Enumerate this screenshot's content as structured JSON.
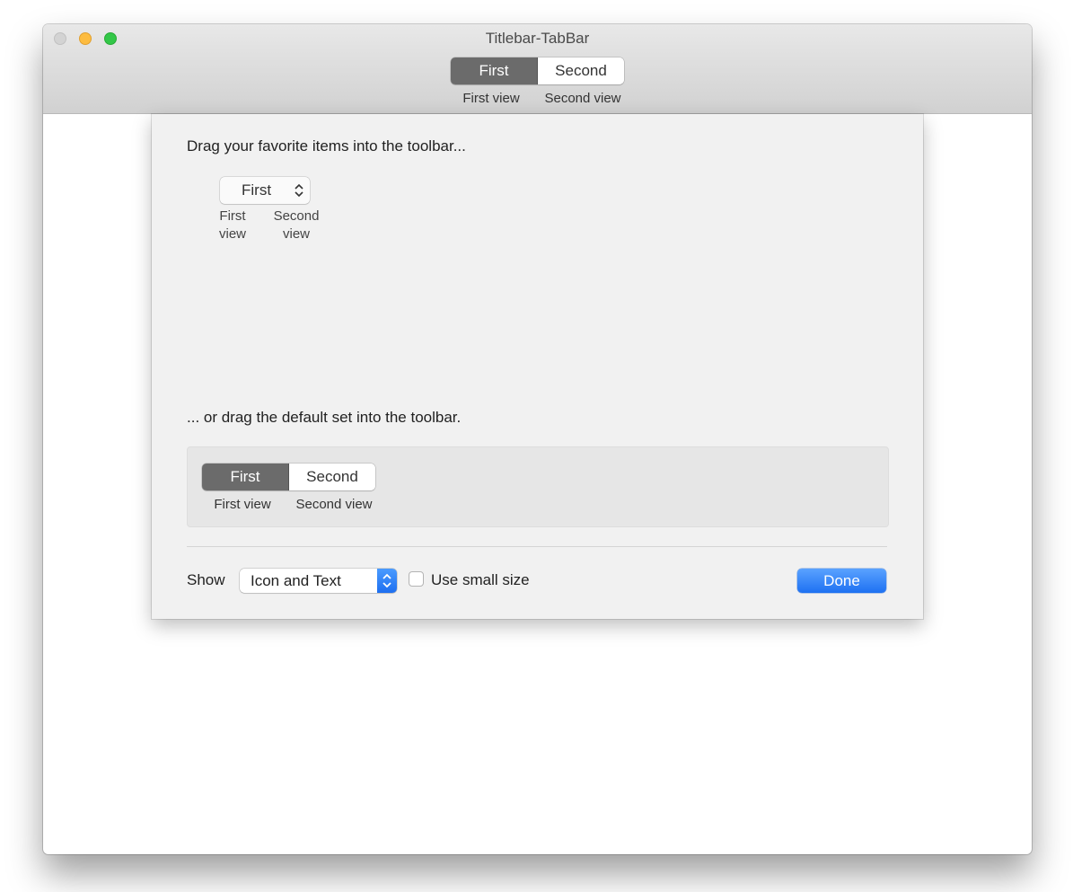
{
  "window": {
    "title": "Titlebar-TabBar",
    "traffic_lights": {
      "close": {
        "icon": "close-icon",
        "color": "#d3d3d3"
      },
      "minimize": {
        "icon": "minimize-icon",
        "color": "#fdbc40"
      },
      "zoom": {
        "icon": "zoom-icon",
        "color": "#33c748"
      }
    }
  },
  "toolbar": {
    "segments": [
      {
        "label": "First",
        "selected": true
      },
      {
        "label": "Second",
        "selected": false
      }
    ],
    "item_labels": [
      "First view",
      "Second view"
    ]
  },
  "customize_sheet": {
    "favorites_prompt": "Drag your favorite items into the toolbar...",
    "favorite_item": {
      "popup_value": "First",
      "popup_icon": "up-down-chevron-icon",
      "labels": [
        "First\nview",
        "Second\nview"
      ]
    },
    "default_set_prompt": "... or drag the default set into the toolbar.",
    "default_set": {
      "segments": [
        {
          "label": "First",
          "selected": true
        },
        {
          "label": "Second",
          "selected": false
        }
      ],
      "item_labels": [
        "First view",
        "Second view"
      ]
    },
    "show_label": "Show",
    "show_select": {
      "value": "Icon and Text",
      "icon": "up-down-chevron-icon"
    },
    "small_size_checkbox": {
      "label": "Use small size",
      "checked": false
    },
    "done_button": {
      "label": "Done",
      "color": "#1e71f2"
    }
  }
}
